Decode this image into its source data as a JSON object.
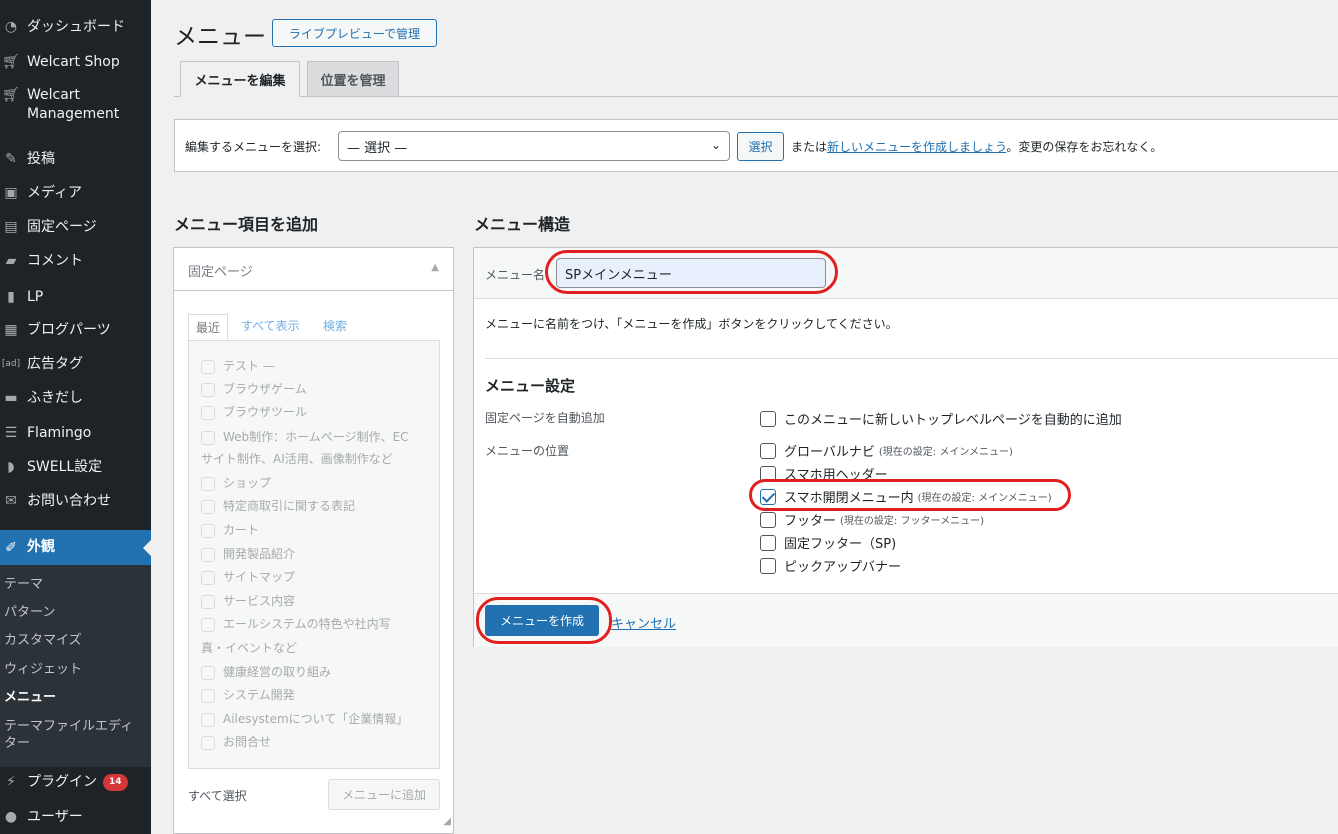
{
  "sidebar": {
    "items": [
      {
        "label": "ダッシュボード",
        "icon": "dashboard-icon"
      },
      {
        "label": "Welcart Shop",
        "icon": "cart-icon"
      },
      {
        "label": "Welcart\nManagement",
        "icon": "cart-icon"
      },
      {
        "label": "投稿",
        "icon": "pin-icon"
      },
      {
        "label": "メディア",
        "icon": "media-icon"
      },
      {
        "label": "固定ページ",
        "icon": "page-icon"
      },
      {
        "label": "コメント",
        "icon": "comment-icon"
      },
      {
        "label": "LP",
        "icon": "document-icon"
      },
      {
        "label": "ブログパーツ",
        "icon": "blocks-icon"
      },
      {
        "label": "広告タグ",
        "icon": "ad-icon"
      },
      {
        "label": "ふきだし",
        "icon": "bubble-icon"
      },
      {
        "label": "Flamingo",
        "icon": "list-icon"
      },
      {
        "label": "SWELL設定",
        "icon": "swell-icon"
      },
      {
        "label": "お問い合わせ",
        "icon": "mail-icon"
      },
      {
        "label": "外観",
        "icon": "brush-icon"
      }
    ],
    "submenu": [
      "テーマ",
      "パターン",
      "カスタマイズ",
      "ウィジェット",
      "メニュー",
      "テーマファイルエディター"
    ],
    "plugins_label": "プラグイン",
    "plugins_badge": "14",
    "users_label": "ユーザー",
    "active_color": "#2271b1"
  },
  "header": {
    "title": "メニュー",
    "live_preview_button": "ライブプレビューで管理"
  },
  "tabs": [
    {
      "label": "メニューを編集",
      "active": true
    },
    {
      "label": "位置を管理",
      "active": false
    }
  ],
  "select_bar": {
    "label": "編集するメニューを選択:",
    "selected": "— 選択 —",
    "select_button": "選択",
    "or_text": "または",
    "create_link": "新しいメニューを作成しましょう",
    "suffix": "。変更の保存をお忘れなく。"
  },
  "add_items": {
    "heading": "メニュー項目を追加",
    "panel_title": "固定ページ",
    "subtabs": [
      "最近",
      "すべて表示",
      "検索"
    ],
    "pages": [
      "テスト —",
      "ブラウザゲーム",
      "ブラウザツール",
      "Web制作：ホームページ制作、EC",
      "サイト制作、AI活用、画像制作など",
      "ショップ",
      "特定商取引に関する表記",
      "カート",
      "開発製品紹介",
      "サイトマップ",
      "サービス内容",
      "エールシステムの特色や社内写",
      "真・イベントなど",
      "健康経営の取り組み",
      "システム開発",
      "Ailesystemについて「企業情報」",
      "お問合せ"
    ],
    "select_all": "すべて選択",
    "add_button": "メニューに追加"
  },
  "structure": {
    "heading": "メニュー構造",
    "name_label": "メニュー名",
    "name_value": "SPメインメニュー",
    "instructions": "メニューに名前をつけ、「メニューを作成」ボタンをクリックしてください。",
    "settings_heading": "メニュー設定",
    "auto_add_label": "固定ページを自動追加",
    "auto_add_option": "このメニューに新しいトップレベルページを自動的に追加",
    "locations_label": "メニューの位置",
    "locations": [
      {
        "label": "グローバルナビ",
        "note": "(現在の設定: メインメニュー)",
        "checked": false
      },
      {
        "label": "スマホ用ヘッダー",
        "note": "",
        "checked": false
      },
      {
        "label": "スマホ開閉メニュー内",
        "note": "(現在の設定: メインメニュー)",
        "checked": true
      },
      {
        "label": "フッター",
        "note": "(現在の設定: フッターメニュー)",
        "checked": false
      },
      {
        "label": "固定フッター（SP)",
        "note": "",
        "checked": false
      },
      {
        "label": "ピックアップバナー",
        "note": "",
        "checked": false
      }
    ],
    "create_button": "メニューを作成",
    "cancel_link": "キャンセル",
    "highlight_color": "#e02020"
  }
}
